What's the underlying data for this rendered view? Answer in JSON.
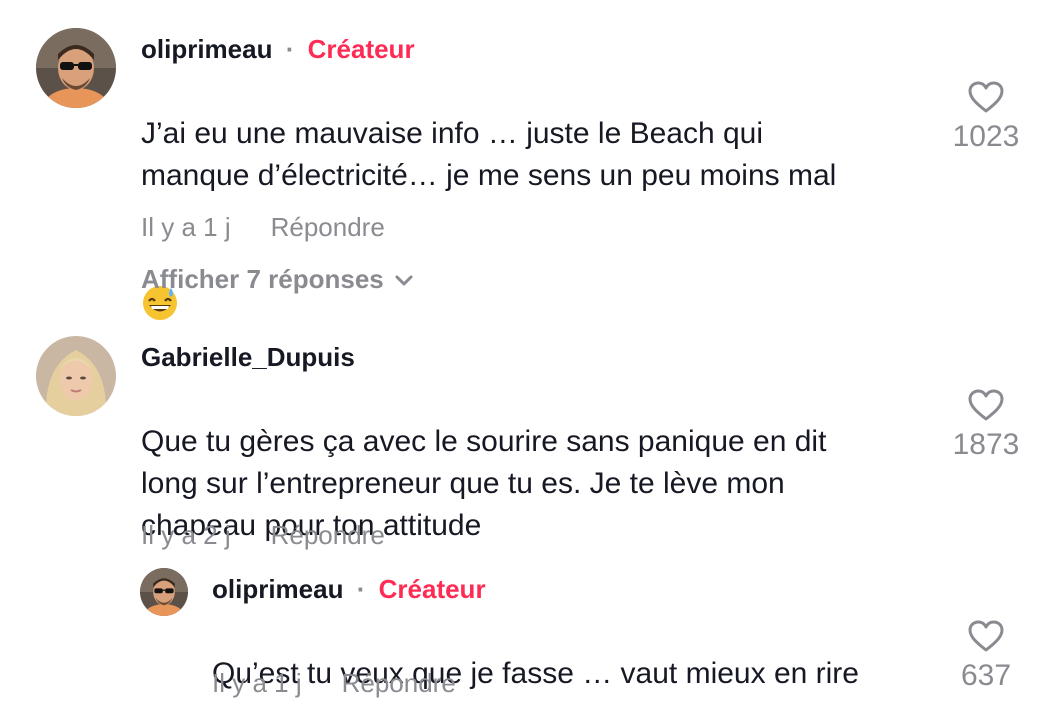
{
  "comments": [
    {
      "username": "oliprimeau",
      "creator_badge": "Créateur",
      "separator": "·",
      "text": "J’ai eu une mauvaise info … juste le Beach qui\nmanque d’électricité… je me sens un peu moins mal",
      "emoji": "grinning-sweat-emoji",
      "time": "Il y a 1 j",
      "reply_label": "Répondre",
      "likes": "1023",
      "view_replies": "Afficher 7 réponses"
    },
    {
      "username": "Gabrielle_Dupuis",
      "text": "Que tu gères ça avec le sourire sans panique en dit\nlong sur l’entrepreneur que tu es. Je te lève mon\nchapeau pour ton attitude",
      "time": "Il y a 2 j",
      "reply_label": "Répondre",
      "likes": "1873"
    },
    {
      "username": "oliprimeau",
      "creator_badge": "Créateur",
      "separator": "·",
      "text": "Qu’est tu veux que je fasse … vaut mieux en rire",
      "time": "Il y a 1 j",
      "reply_label": "Répondre",
      "likes": "637"
    }
  ],
  "colors": {
    "creator": "#fe2c55",
    "muted": "#8a8b91",
    "text": "#161823"
  },
  "icons": {
    "like": "heart-outline-icon",
    "expand": "chevron-down-icon"
  }
}
